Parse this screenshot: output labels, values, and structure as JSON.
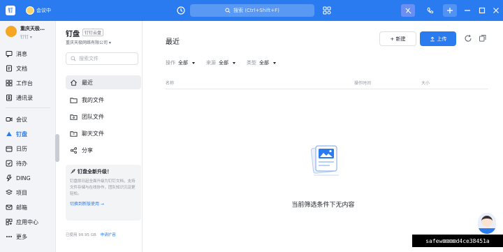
{
  "titlebar": {
    "app_logo_text": "钉",
    "meeting_label": "会议中",
    "search_placeholder": "搜索 (Ctrl+Shift+F)",
    "accent": "#2b7bf0"
  },
  "org": {
    "name": "重庆天极…",
    "status": "钉钉  ▾"
  },
  "leftnav": {
    "items": [
      {
        "label": "消息",
        "icon": "message-icon"
      },
      {
        "label": "文档",
        "icon": "document-icon"
      },
      {
        "label": "工作台",
        "icon": "workbench-icon"
      },
      {
        "label": "通讯录",
        "icon": "contacts-icon"
      },
      {
        "label": "会议",
        "icon": "meeting-icon"
      },
      {
        "label": "钉盘",
        "icon": "cloud-drive-icon"
      },
      {
        "label": "日历",
        "icon": "calendar-icon"
      },
      {
        "label": "待办",
        "icon": "todo-icon"
      },
      {
        "label": "DING",
        "icon": "ding-icon"
      },
      {
        "label": "项目",
        "icon": "project-icon"
      },
      {
        "label": "邮箱",
        "icon": "mail-icon"
      },
      {
        "label": "应用中心",
        "icon": "app-center-icon"
      },
      {
        "label": "更多",
        "icon": "more-icon"
      }
    ]
  },
  "drive": {
    "title": "钉盘",
    "tag": "钉钉云盘",
    "org": "重庆天极网络有限公司 ▾",
    "search_placeholder": "搜索文件",
    "items": [
      {
        "label": "最近",
        "icon": "home-icon"
      },
      {
        "label": "我的文件",
        "icon": "folder-icon"
      },
      {
        "label": "团队文件",
        "icon": "team-folder-icon"
      },
      {
        "label": "聊天文件",
        "icon": "chat-folder-icon"
      },
      {
        "label": "分享",
        "icon": "share-icon"
      }
    ],
    "promo": {
      "title": "钉盘全新升级！",
      "desc": "钉盘即日起全面升级为钉钉文档，支持文件存储与在线协作，团队知识沉淀更轻松。",
      "link": "切换到新版使用 →"
    },
    "storage": {
      "used": "已使用 99.95 GB",
      "expand": "申请扩容"
    }
  },
  "main": {
    "title": "最近",
    "new_label": "+ 新建",
    "upload_label": "上传",
    "filters": [
      {
        "label": "操作",
        "value": "全部"
      },
      {
        "label": "来源",
        "value": "全部"
      },
      {
        "label": "类型",
        "value": "全部"
      }
    ],
    "columns": {
      "name": "名称",
      "op_time": "操作时间",
      "size": "大小"
    },
    "empty_text": "当前筛选条件下无内容"
  },
  "overlay_badge": "safew⊠⊠⊠⊠d4ce38451a"
}
